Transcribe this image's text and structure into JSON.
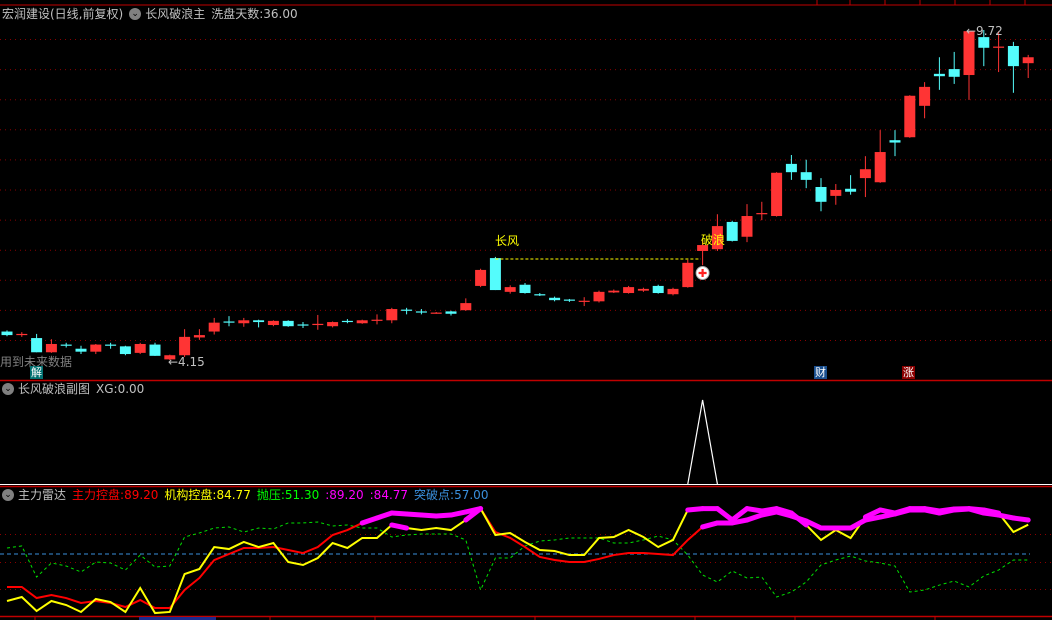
{
  "main_header": {
    "stock": "宏润建设(日线,前复权)",
    "indicator": "长风破浪主",
    "param_label": "洗盘天数:",
    "param_value": "36.00"
  },
  "sub_header": {
    "indicator": "长风破浪副图",
    "xg_label": "XG:",
    "xg_value": "0.00"
  },
  "radar_header": {
    "indicator": "主力雷达",
    "main_label": "主力控盘:",
    "main_value": "89.20",
    "inst_label": "机构控盘:",
    "inst_value": "84.77",
    "press_label": "抛压:",
    "press_value": "51.30",
    "mag1": ":89.20",
    "mag2": ":84.77",
    "break_label": "突破点:",
    "break_value": "57.00"
  },
  "annotations": {
    "future_data": "用到未来数据",
    "changfeng": "长风",
    "polang": "破浪",
    "low_label": "←4.15",
    "high_label": "←9.72",
    "badge_jie": "解",
    "badge_cai": "财",
    "badge_zhang": "涨"
  },
  "colors": {
    "up": "#ff3434",
    "down": "#54fcfc",
    "grid": "#8b0000",
    "main_line": "#ff0000",
    "inst_line": "#ffff00",
    "press_line": "#00e000",
    "hot": "#ff00ff",
    "break_line": "#3a8fdc"
  },
  "chart_data": {
    "type": "candlestick",
    "price_range": [
      4.15,
      9.72
    ],
    "candles_ohlc": [
      [
        4.63,
        4.57,
        4.65,
        4.55
      ],
      [
        4.58,
        4.59,
        4.62,
        4.54
      ],
      [
        4.52,
        4.28,
        4.59,
        4.28
      ],
      [
        4.28,
        4.42,
        4.5,
        4.27
      ],
      [
        4.41,
        4.4,
        4.44,
        4.36
      ],
      [
        4.34,
        4.29,
        4.39,
        4.25
      ],
      [
        4.29,
        4.41,
        4.42,
        4.25
      ],
      [
        4.41,
        4.4,
        4.44,
        4.34
      ],
      [
        4.38,
        4.25,
        4.39,
        4.23
      ],
      [
        4.27,
        4.42,
        4.44,
        4.25
      ],
      [
        4.41,
        4.22,
        4.44,
        4.22
      ],
      [
        4.16,
        4.23,
        4.24,
        4.15
      ],
      [
        4.23,
        4.54,
        4.67,
        4.2
      ],
      [
        4.53,
        4.57,
        4.67,
        4.49
      ],
      [
        4.63,
        4.78,
        4.86,
        4.58
      ],
      [
        4.8,
        4.79,
        4.89,
        4.72
      ],
      [
        4.77,
        4.82,
        4.86,
        4.71
      ],
      [
        4.82,
        4.79,
        4.83,
        4.7
      ],
      [
        4.74,
        4.81,
        4.82,
        4.72
      ],
      [
        4.81,
        4.72,
        4.82,
        4.71
      ],
      [
        4.75,
        4.74,
        4.79,
        4.69
      ],
      [
        4.74,
        4.76,
        4.91,
        4.66
      ],
      [
        4.72,
        4.79,
        4.8,
        4.7
      ],
      [
        4.81,
        4.8,
        4.84,
        4.77
      ],
      [
        4.77,
        4.82,
        4.83,
        4.76
      ],
      [
        4.82,
        4.83,
        4.92,
        4.75
      ],
      [
        4.82,
        5.01,
        5.03,
        4.77
      ],
      [
        5.0,
        4.98,
        5.03,
        4.92
      ],
      [
        4.97,
        4.95,
        5.01,
        4.92
      ],
      [
        4.94,
        4.95,
        4.96,
        4.93
      ],
      [
        4.97,
        4.93,
        4.98,
        4.9
      ],
      [
        4.99,
        5.11,
        5.19,
        4.98
      ],
      [
        5.4,
        5.67,
        5.69,
        5.38
      ],
      [
        5.87,
        5.33,
        5.89,
        5.33
      ],
      [
        5.3,
        5.38,
        5.41,
        5.27
      ],
      [
        5.42,
        5.28,
        5.45,
        5.27
      ],
      [
        5.26,
        5.25,
        5.28,
        5.23
      ],
      [
        5.2,
        5.16,
        5.22,
        5.14
      ],
      [
        5.17,
        5.15,
        5.18,
        5.13
      ],
      [
        5.14,
        5.15,
        5.21,
        5.06
      ],
      [
        5.14,
        5.3,
        5.32,
        5.12
      ],
      [
        5.29,
        5.32,
        5.34,
        5.28
      ],
      [
        5.28,
        5.38,
        5.4,
        5.27
      ],
      [
        5.32,
        5.35,
        5.37,
        5.3
      ],
      [
        5.4,
        5.28,
        5.42,
        5.27
      ],
      [
        5.26,
        5.35,
        5.37,
        5.24
      ],
      [
        5.38,
        5.79,
        5.84,
        5.37
      ],
      [
        5.99,
        6.09,
        6.16,
        5.75
      ],
      [
        6.02,
        6.41,
        6.61,
        5.99
      ],
      [
        6.48,
        6.16,
        6.5,
        6.15
      ],
      [
        6.23,
        6.58,
        6.78,
        6.14
      ],
      [
        6.62,
        6.63,
        6.82,
        6.51
      ],
      [
        6.58,
        7.31,
        7.32,
        6.57
      ],
      [
        7.46,
        7.32,
        7.61,
        7.19
      ],
      [
        7.32,
        7.19,
        7.53,
        7.05
      ],
      [
        7.07,
        6.82,
        7.22,
        6.66
      ],
      [
        6.92,
        7.02,
        7.12,
        6.77
      ],
      [
        7.04,
        6.99,
        7.27,
        6.94
      ],
      [
        7.22,
        7.37,
        7.59,
        6.9
      ],
      [
        7.15,
        7.66,
        8.03,
        7.14
      ],
      [
        7.86,
        7.82,
        8.03,
        7.59
      ],
      [
        7.91,
        8.61,
        8.62,
        7.9
      ],
      [
        8.44,
        8.76,
        8.84,
        8.23
      ],
      [
        8.98,
        8.94,
        9.26,
        8.71
      ],
      [
        9.06,
        8.93,
        9.35,
        8.81
      ],
      [
        8.96,
        9.7,
        9.7,
        8.54
      ],
      [
        9.6,
        9.42,
        9.72,
        9.11
      ],
      [
        9.42,
        9.44,
        9.7,
        9.01
      ],
      [
        9.45,
        9.11,
        9.52,
        8.66
      ],
      [
        9.16,
        9.26,
        9.3,
        8.91
      ]
    ],
    "signal_index_changfeng": 33,
    "signal_index_polang": 47,
    "xg_series_spike_index": 47,
    "radar": {
      "range": [
        0,
        100
      ],
      "break_level": 57,
      "hot_threshold": 80,
      "main_control": [
        25.8,
        25.8,
        15.3,
        18.2,
        15.3,
        10.6,
        12.5,
        10.6,
        6.8,
        13.4,
        5.9,
        5.9,
        22.9,
        34.3,
        51.3,
        57,
        62.7,
        62.7,
        63.6,
        60.8,
        57.9,
        63.6,
        75,
        79.7,
        86.4,
        91.1,
        95.8,
        94.9,
        93.9,
        93,
        93.9,
        96.8,
        100,
        77.8,
        72.2,
        63.6,
        54.2,
        51.3,
        49.4,
        49.4,
        52.3,
        56,
        57.9,
        57.9,
        57,
        56,
        70.3,
        82.6,
        86.4,
        86.4,
        89.2,
        93.9,
        96.8,
        93,
        88.3,
        81.6,
        81.6,
        81.6,
        89.2,
        92,
        94.9,
        98.7,
        98.7,
        95.8,
        98.7,
        99.6,
        95.8,
        93.9,
        91.1,
        89.2
      ],
      "inst_control": [
        12.5,
        16.3,
        3,
        12.5,
        8.7,
        2.1,
        14.4,
        11.5,
        2.1,
        24.8,
        1.1,
        2.1,
        38,
        42.8,
        63.6,
        61.7,
        68.4,
        63.6,
        67.4,
        49.4,
        46.6,
        53.2,
        67.4,
        62.7,
        72.2,
        72.2,
        84.5,
        81.6,
        79.7,
        81.6,
        79.7,
        89.2,
        100,
        75,
        76.9,
        68.4,
        60.8,
        59.8,
        56,
        56,
        72.2,
        73.1,
        79.7,
        73.1,
        63.6,
        70.3,
        98.7,
        100,
        100,
        89.2,
        100,
        97.7,
        100,
        95.8,
        84.5,
        70.3,
        79.7,
        72.1,
        92,
        98.7,
        95.8,
        100,
        100,
        97.7,
        99.6,
        100,
        98.7,
        95.8,
        77.8,
        84.77
      ],
      "pressure": [
        62.7,
        64.6,
        35.2,
        48.5,
        45.6,
        40,
        49.4,
        48.5,
        41.8,
        56,
        44.7,
        45.6,
        73.1,
        76.9,
        81.6,
        82.6,
        77.8,
        81.6,
        80.7,
        86.4,
        86.4,
        87.3,
        83.5,
        84.5,
        81.6,
        81.6,
        73.1,
        75,
        75.9,
        75.9,
        75.9,
        70.3,
        22.9,
        53.2,
        53.2,
        64.6,
        69.3,
        70.3,
        72.2,
        72.2,
        72.2,
        67.4,
        67.4,
        70.3,
        74,
        70.3,
        56,
        37.1,
        30.5,
        40.9,
        34.3,
        35.2,
        16.3,
        21,
        30.5,
        46.6,
        51.3,
        55.1,
        50.4,
        48.5,
        45.6,
        21,
        22.9,
        27.6,
        31.4,
        25.8,
        36.2,
        41.8,
        51.3,
        51.3
      ]
    }
  }
}
